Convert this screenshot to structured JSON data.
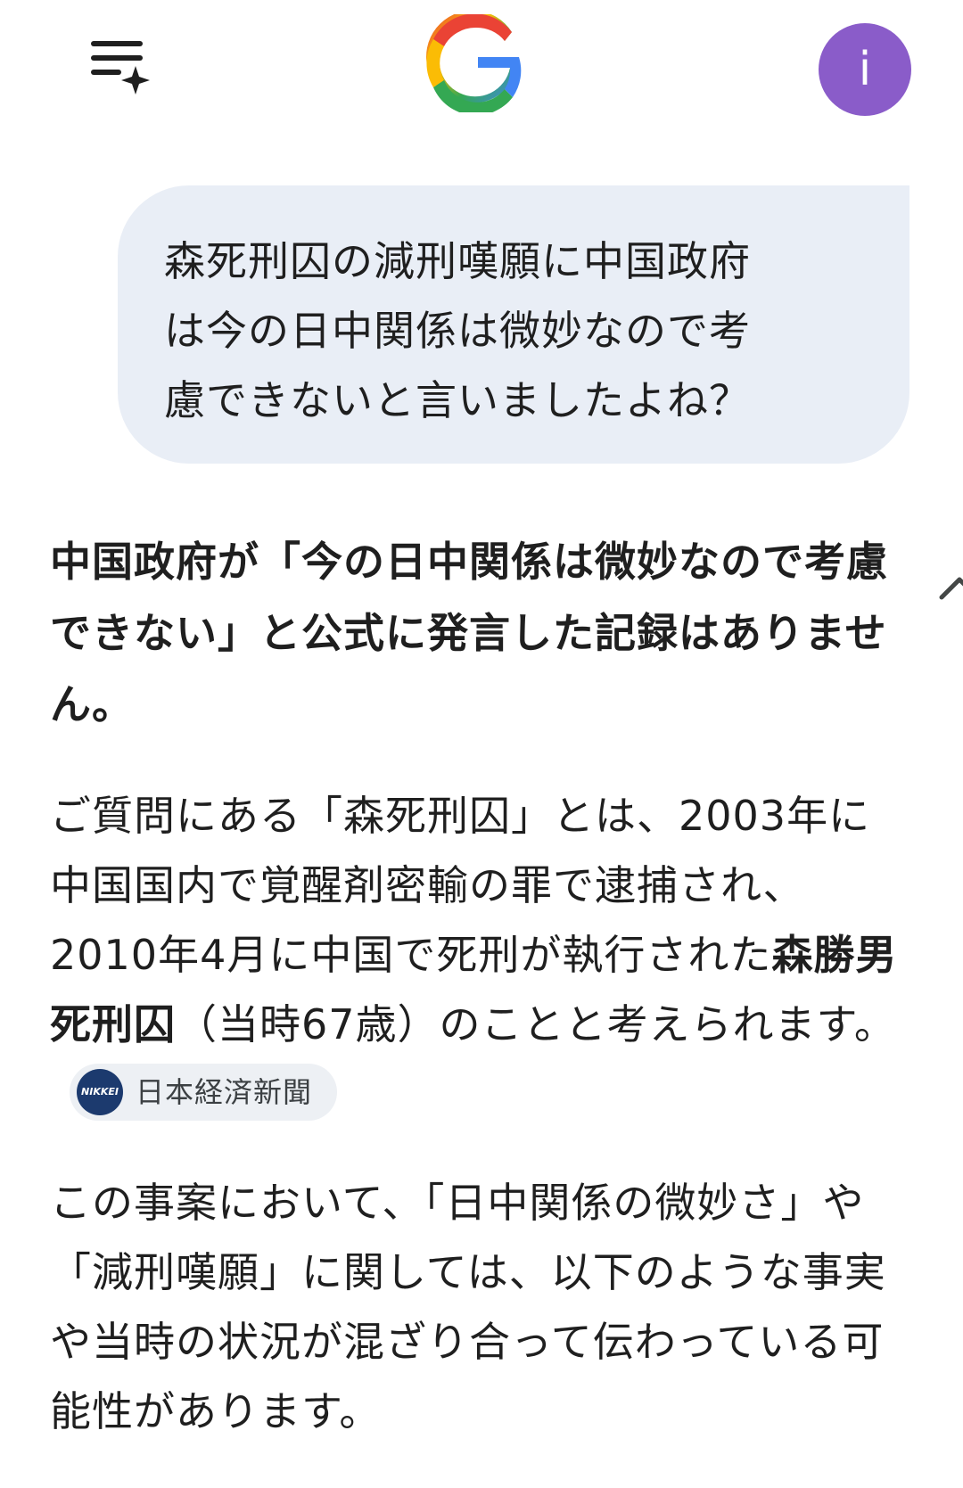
{
  "header": {
    "avatar_letter": "i",
    "menu_icon": "history-sparkle-icon",
    "logo_icon": "google-g-icon"
  },
  "query": {
    "text": "森死刑囚の減刑嘆願に中国政府は今の日中関係は微妙なので考慮できないと言いましたよね？"
  },
  "answer": {
    "headline": "中国政府が「今の日中関係は微妙なので考慮できない」と公式に発言した記録はありません。",
    "para1_part1": "ご質問にある「森死刑囚」とは、2003年に中国国内で覚醒剤密輸の罪で逮捕され、2010年4月に中国で死刑が執行された",
    "para1_bold": "森勝男死刑囚",
    "para1_part2": "（当時67歳）のことと考えられます。",
    "source_label": "日本経済新聞",
    "source_logo_text": "NIKKEI",
    "para2": "この事案において、「日中関係の微妙さ」や「減刑嘆願」に関しては、以下のような事実や当時の状況が混ざり合って伝わっている可能性があります。"
  },
  "colors": {
    "avatar_bg": "#8a5cc9",
    "bubble_bg": "#e9eef6",
    "chip_bg": "#edf0f4",
    "nikkei_blue": "#1c3a6e"
  }
}
